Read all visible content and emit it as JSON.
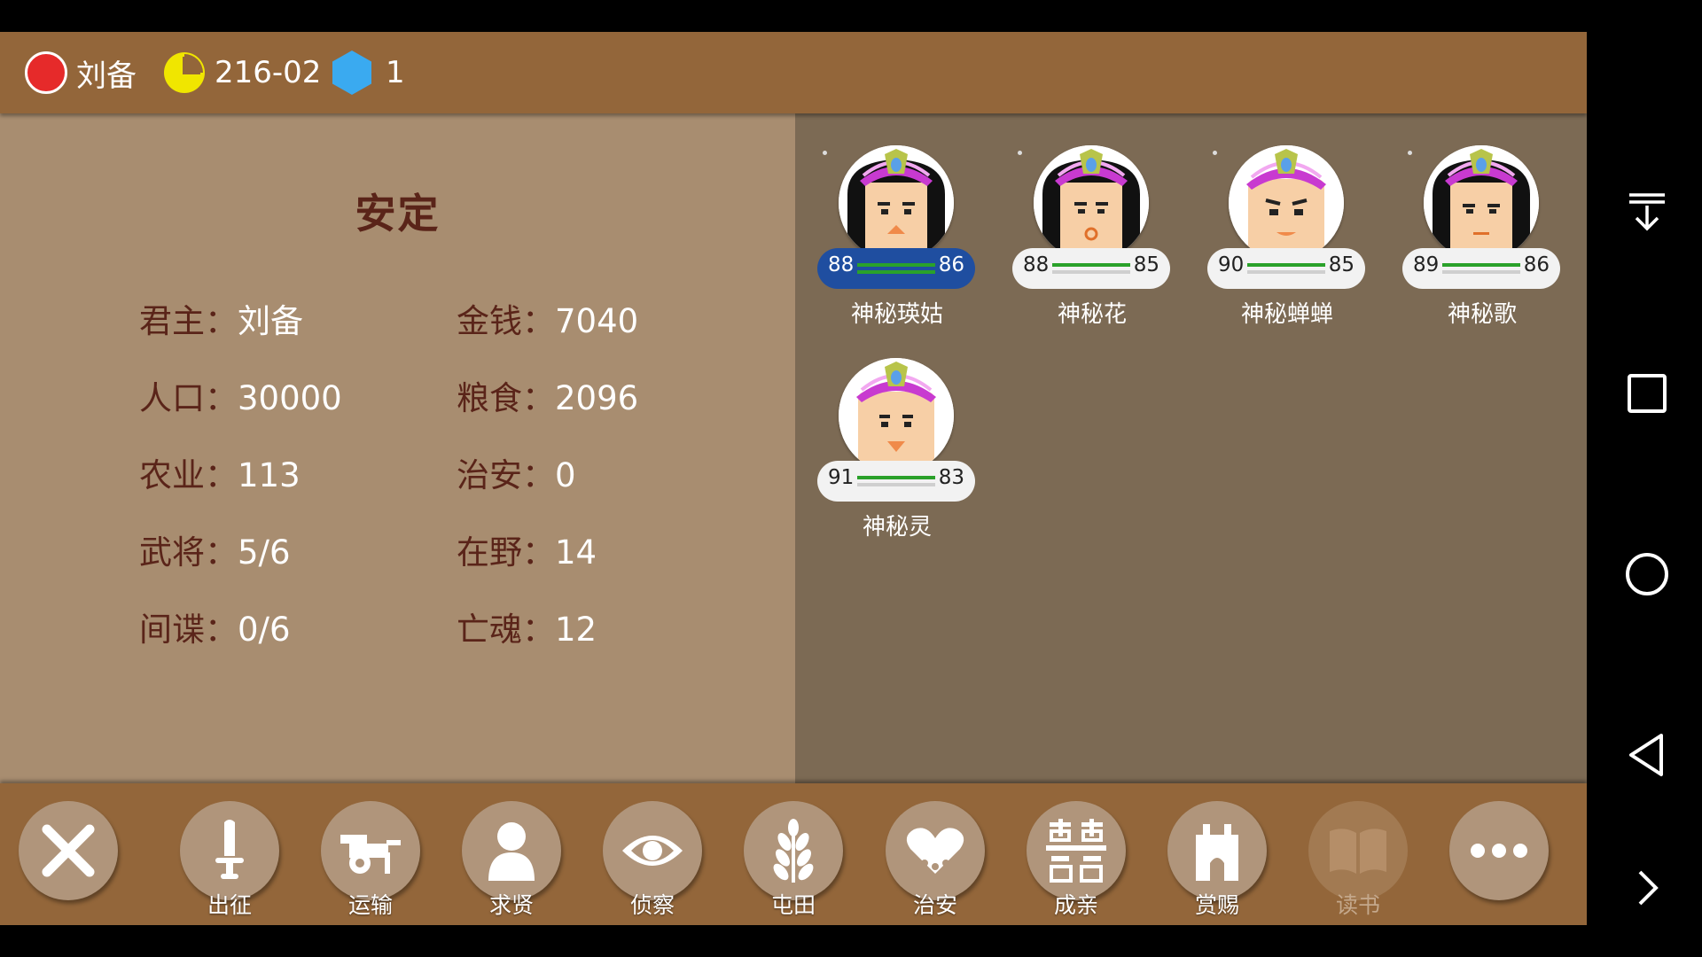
{
  "topbar": {
    "lord": "刘备",
    "date": "216-02",
    "gems": "1",
    "colors": {
      "lord_dot": "#e62a2a",
      "clock": "#f0e600",
      "gem": "#3aaaf0"
    }
  },
  "city": {
    "name": "安定",
    "stats_left": [
      {
        "label": "君主：",
        "value": "刘备"
      },
      {
        "label": "人口：",
        "value": "30000"
      },
      {
        "label": "农业：",
        "value": "113"
      },
      {
        "label": "武将：",
        "value": "5/6"
      },
      {
        "label": "间谍：",
        "value": "0/6"
      }
    ],
    "stats_right": [
      {
        "label": "金钱：",
        "value": "7040"
      },
      {
        "label": "粮食：",
        "value": "2096"
      },
      {
        "label": "治安：",
        "value": "0"
      },
      {
        "label": "在野：",
        "value": "14"
      },
      {
        "label": "亡魂：",
        "value": "12"
      }
    ]
  },
  "officers": [
    {
      "name": "神秘瑛姑",
      "left": "88",
      "right": "86",
      "selected": true
    },
    {
      "name": "神秘花",
      "left": "88",
      "right": "85",
      "selected": false
    },
    {
      "name": "神秘蝉蝉",
      "left": "90",
      "right": "85",
      "selected": false
    },
    {
      "name": "神秘歌",
      "left": "89",
      "right": "86",
      "selected": false
    },
    {
      "name": "神秘灵",
      "left": "91",
      "right": "83",
      "selected": false
    }
  ],
  "actions": [
    {
      "id": "close",
      "label": "",
      "icon": "close-icon"
    },
    {
      "id": "expedition",
      "label": "出征",
      "icon": "sword-icon"
    },
    {
      "id": "transport",
      "label": "运输",
      "icon": "cart-icon"
    },
    {
      "id": "recruit",
      "label": "求贤",
      "icon": "person-icon"
    },
    {
      "id": "scout",
      "label": "侦察",
      "icon": "eye-icon"
    },
    {
      "id": "farm",
      "label": "屯田",
      "icon": "wheat-icon"
    },
    {
      "id": "security",
      "label": "治安",
      "icon": "hearts-icon"
    },
    {
      "id": "marry",
      "label": "成亲",
      "icon": "double-happiness-icon"
    },
    {
      "id": "reward",
      "label": "赏赐",
      "icon": "castle-icon"
    },
    {
      "id": "study",
      "label": "读书",
      "icon": "book-icon",
      "disabled": true
    },
    {
      "id": "more",
      "label": "",
      "icon": "more-icon"
    }
  ],
  "nav": [
    "collapse-icon",
    "recents-icon",
    "home-icon",
    "back-icon",
    "next-icon"
  ]
}
